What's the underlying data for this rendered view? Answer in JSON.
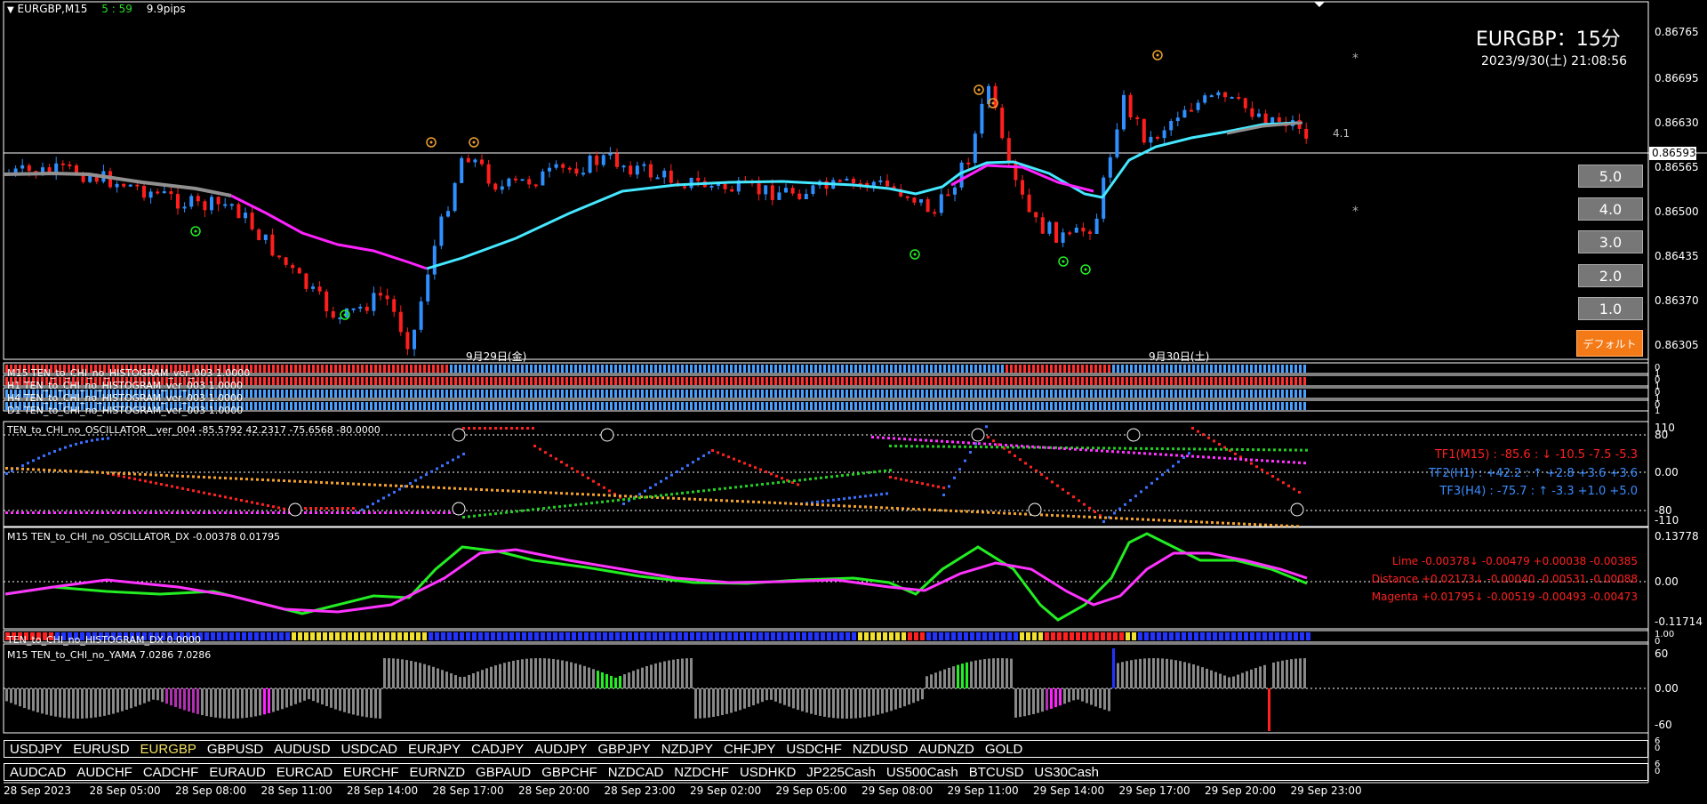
{
  "header": {
    "symbol": "EURGBP,M15",
    "timer": "5 : 59",
    "spread": "9.9pips"
  },
  "title_overlay": {
    "pair_title": "EURGBP：15分",
    "datetime": "2023/9/30(土) 21:08:56"
  },
  "price_axis": [
    "0.86765",
    "0.86695",
    "0.86630",
    "0.86565",
    "0.86500",
    "0.86435",
    "0.86370",
    "0.86305"
  ],
  "current_price": "0.86593",
  "chart_annotation": "4.1",
  "date_labels": {
    "day1": "9月29日(金)",
    "day2": "9月30日(土)"
  },
  "preset_buttons": [
    "5.0",
    "4.0",
    "3.0",
    "2.0",
    "1.0"
  ],
  "default_button": "デフォルト",
  "histogram_strips": [
    "M15 TEN_to_CHI_no_HISTOGRAM_ver_003 1.0000",
    "H1 TEN_to_CHI_no_HISTOGRAM_ver_003 1.0000",
    "H4 TEN_to_CHI_no_HISTOGRAM_ver_003 1.0000",
    "D1 TEN_to_CHI_no_HISTOGRAM_ver_003 1.0000"
  ],
  "oscillator": {
    "title": "TEN_to_CHI_no_OSCILLATOR__ver_004 -85.5792 42.2317 -75.6568 -80.0000",
    "axis": [
      "110",
      "80",
      "0.00",
      "-80",
      "-110"
    ],
    "tf1": "TF1(M15) : -85.6 : ↓ -10.5 -7.5 -5.3",
    "tf2": "TF2(H1) : +42.2 : ↑ +2.8 +3.6 +3.6",
    "tf3": "TF3(H4) : -75.7 : ↑ -3.3 +1.0 +5.0"
  },
  "dx": {
    "title": "M15 TEN_to_CHI_no_OSCILLATOR_DX -0.00378 0.01795",
    "axis": [
      "0.13778",
      "0.00",
      "-0.11714"
    ],
    "lime": "Lime -0.00378↓ -0.00479 +0.00038 -0.00385",
    "distance": "Distance +0.02173↓ -0.00040 -0.00531 -0.00088",
    "magenta": "Magenta +0.01795↓ -0.00519 -0.00493 -0.00473"
  },
  "hist_dx": {
    "title": "TEN_to_CHI_no_HISTOGRAM_DX 0.0000",
    "axis": [
      "1.00",
      "0"
    ]
  },
  "yama": {
    "title": "M15 TEN_to_CHI_no_YAMA 7.0286 7.0286",
    "axis": [
      "60",
      "0.00",
      "-60"
    ]
  },
  "symbols_row1": [
    "USDJPY",
    "EURUSD",
    "EURGBP",
    "GBPUSD",
    "AUDUSD",
    "USDCAD",
    "EURJPY",
    "CADJPY",
    "AUDJPY",
    "GBPJPY",
    "NZDJPY",
    "CHFJPY",
    "USDCHF",
    "NZDUSD",
    "AUDNZD",
    "GOLD"
  ],
  "symbols_row1_active": "EURGBP",
  "symbols_row2": [
    "AUDCAD",
    "AUDCHF",
    "CADCHF",
    "EURAUD",
    "EURCAD",
    "EURCHF",
    "EURNZD",
    "GBPAUD",
    "GBPCHF",
    "NZDCAD",
    "NZDCHF",
    "USDHKD",
    "JP225Cash",
    "US500Cash",
    "BTCUSD",
    "US30Cash"
  ],
  "time_axis": [
    "28 Sep 2023",
    "28 Sep 05:00",
    "28 Sep 08:00",
    "28 Sep 11:00",
    "28 Sep 14:00",
    "28 Sep 17:00",
    "28 Sep 20:00",
    "28 Sep 23:00",
    "29 Sep 02:00",
    "29 Sep 05:00",
    "29 Sep 08:00",
    "29 Sep 11:00",
    "29 Sep 14:00",
    "29 Sep 17:00",
    "29 Sep 20:00",
    "29 Sep 23:00"
  ],
  "colors": {
    "bull": "#2f8fff",
    "bear": "#ff1e1e",
    "ma_fast": "#ff22ff",
    "ma_slow": "#44e8ff",
    "ma_gray": "#909090",
    "lime": "#22ee22",
    "magenta": "#ff33ff",
    "tf1": "#ff2020",
    "tf2": "#3a8dff",
    "tf3": "#3a8dff"
  }
}
